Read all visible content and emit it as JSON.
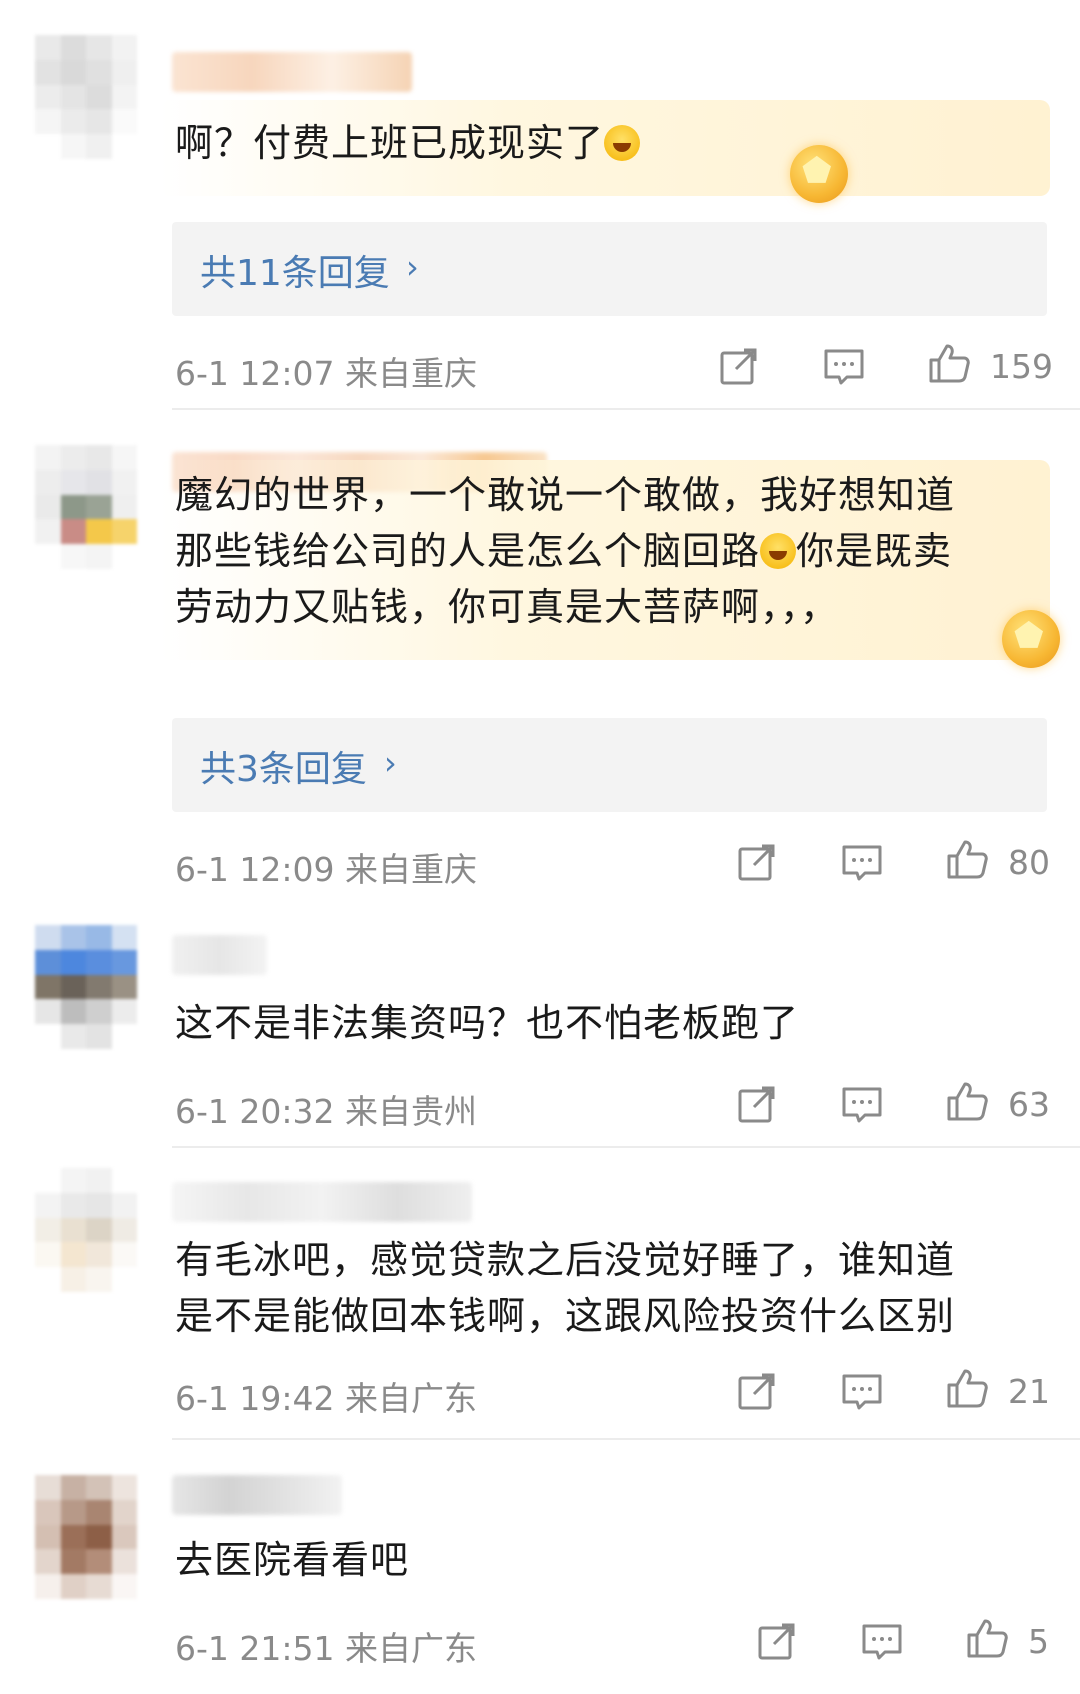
{
  "comments": [
    {
      "text_lines": [
        "啊？付费上班已成现实了"
      ],
      "has_emoji_end": true,
      "replies_label": "共11条回复",
      "arrow": "›",
      "time": "6-1 12:07",
      "location": "来自重庆",
      "likes": "159"
    },
    {
      "text_lines": [
        "魔幻的世界，一个敢说一个敢做，我好想知道",
        "那些钱给公司的人是怎么个脑回路",
        "你是既卖",
        "劳动力又贴钱，你可真是大菩萨啊，，，"
      ],
      "replies_label": "共3条回复",
      "arrow": "›",
      "time": "6-1 12:09",
      "location": "来自重庆",
      "likes": "80"
    },
    {
      "text_lines": [
        "这不是非法集资吗？也不怕老板跑了"
      ],
      "time": "6-1 20:32",
      "location": "来自贵州",
      "likes": "63"
    },
    {
      "text_lines": [
        "有毛冰吧，感觉贷款之后没觉好睡了，谁知道",
        "是不是能做回本钱啊，这跟风险投资什么区别"
      ],
      "time": "6-1 19:42",
      "location": "来自广东",
      "likes": "21"
    },
    {
      "text_lines": [
        "去医院看看吧"
      ],
      "time": "6-1 21:51",
      "location": "来自广东",
      "likes": "5"
    }
  ],
  "icons": {
    "share": "share-icon",
    "comment": "comment-icon",
    "like": "thumbs-up-icon",
    "emoji": "laughing-emoji-icon",
    "badge": "fan-badge-icon"
  },
  "colors": {
    "link": "#4a7bb3",
    "meta": "#8a8a8a",
    "reply_bg": "#f3f3f3"
  }
}
